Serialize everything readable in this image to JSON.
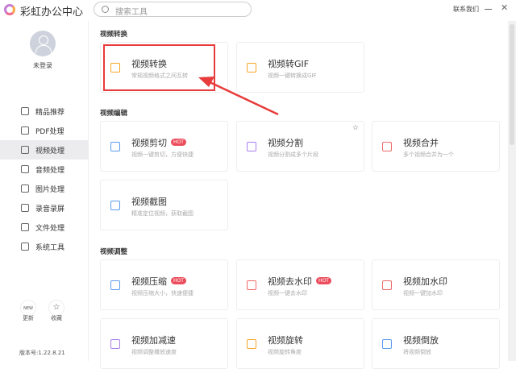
{
  "header": {
    "title": "彩虹办公中心",
    "search_placeholder": "搜索工具",
    "contact": "联系我们",
    "minimize": "—",
    "close": "✕"
  },
  "sidebar": {
    "user": "未登录",
    "items": [
      {
        "label": "精品推荐",
        "icon": "thumbs-up-icon"
      },
      {
        "label": "PDF处理",
        "icon": "pdf-icon"
      },
      {
        "label": "视频处理",
        "icon": "video-icon",
        "active": true
      },
      {
        "label": "音频处理",
        "icon": "music-icon"
      },
      {
        "label": "图片处理",
        "icon": "image-icon"
      },
      {
        "label": "录音录屏",
        "icon": "record-icon"
      },
      {
        "label": "文件处理",
        "icon": "folder-icon"
      },
      {
        "label": "系统工具",
        "icon": "system-icon"
      }
    ],
    "update": "更新",
    "favorite": "收藏",
    "update_badge": "NEW",
    "version": "版本号:1.22.8.21"
  },
  "sections": [
    {
      "title": "视频转换",
      "cards": [
        {
          "title": "视频转换",
          "desc": "常规视频格式之间互转",
          "color": "#f5a623"
        },
        {
          "title": "视频转GIF",
          "desc": "视频一键转换成GIF",
          "color": "#f5a623"
        }
      ]
    },
    {
      "title": "视频编辑",
      "cards": [
        {
          "title": "视频剪切",
          "desc": "视频一键剪切，方便快捷",
          "hot": "HOT",
          "color": "#5b9bf0"
        },
        {
          "title": "视频分割",
          "desc": "视频分割成多个片段",
          "color": "#a77ef0",
          "star": true
        },
        {
          "title": "视频合并",
          "desc": "多个视频合并为一个",
          "color": "#f06a6a"
        },
        {
          "title": "视频截图",
          "desc": "精准定位视频，获取截图",
          "color": "#5b9bf0"
        }
      ]
    },
    {
      "title": "视频调整",
      "cards": [
        {
          "title": "视频压缩",
          "desc": "视频压缩大小，快速便捷",
          "hot": "HOT",
          "color": "#5b9bf0"
        },
        {
          "title": "视频去水印",
          "desc": "视频一键去水印",
          "hot": "HOT",
          "color": "#f06a6a"
        },
        {
          "title": "视频加水印",
          "desc": "视频一键加水印",
          "color": "#f06a6a"
        },
        {
          "title": "视频加减速",
          "desc": "视频调整播放速度",
          "color": "#a77ef0"
        },
        {
          "title": "视频旋转",
          "desc": "视频旋转角度",
          "color": "#f5a623"
        },
        {
          "title": "视频倒放",
          "desc": "将视频倒放",
          "color": "#5b9bf0"
        }
      ]
    }
  ]
}
